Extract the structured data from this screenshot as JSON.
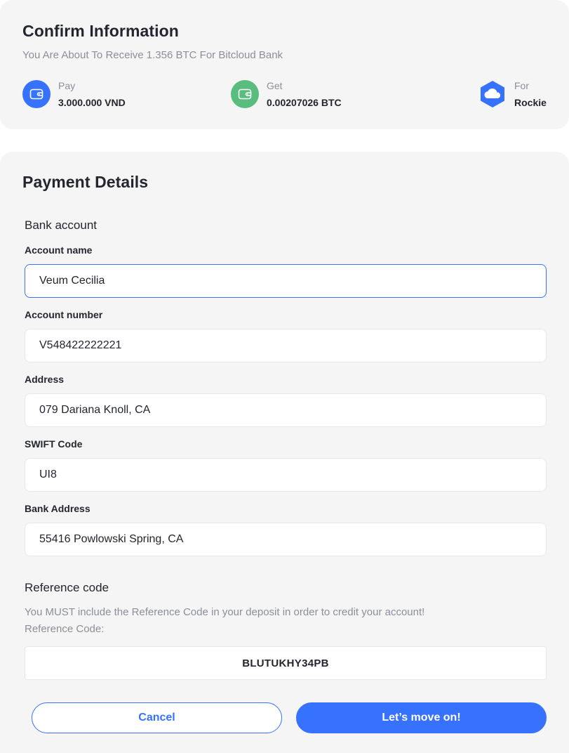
{
  "confirm": {
    "title": "Confirm Information",
    "subtitle": "You Are About To Receive 1.356 BTC For Bitcloud Bank",
    "pay": {
      "label": "Pay",
      "value": "3.000.000 VND",
      "icon": "wallet-icon",
      "color": "#3772ff"
    },
    "get": {
      "label": "Get",
      "value": "0.00207026 BTC",
      "icon": "wallet-icon",
      "color": "#58bd7d"
    },
    "for": {
      "label": "For",
      "value": "Rockie",
      "icon": "cloud-hexagon-logo",
      "color": "#3772ff"
    }
  },
  "payment": {
    "title": "Payment Details",
    "bank_section": "Bank account",
    "fields": {
      "account_name": {
        "label": "Account name",
        "value": "Veum Cecilia"
      },
      "account_number": {
        "label": "Account number",
        "value": "V548422222221"
      },
      "address": {
        "label": "Address",
        "value": "079 Dariana Knoll, CA"
      },
      "swift": {
        "label": "SWIFT Code",
        "value": "UI8"
      },
      "bank_address": {
        "label": "Bank Address",
        "value": "55416 Powlowski Spring, CA"
      }
    },
    "reference": {
      "title": "Reference code",
      "note": "You MUST include the Reference Code in your deposit in order to credit your account!",
      "label": "Reference Code:",
      "code": "BLUTUKHY34PB"
    }
  },
  "actions": {
    "cancel": "Cancel",
    "next": "Let’s move on!"
  },
  "colors": {
    "accent": "#3772ff",
    "success": "#58bd7d",
    "card_bg": "#f5f5f6"
  }
}
